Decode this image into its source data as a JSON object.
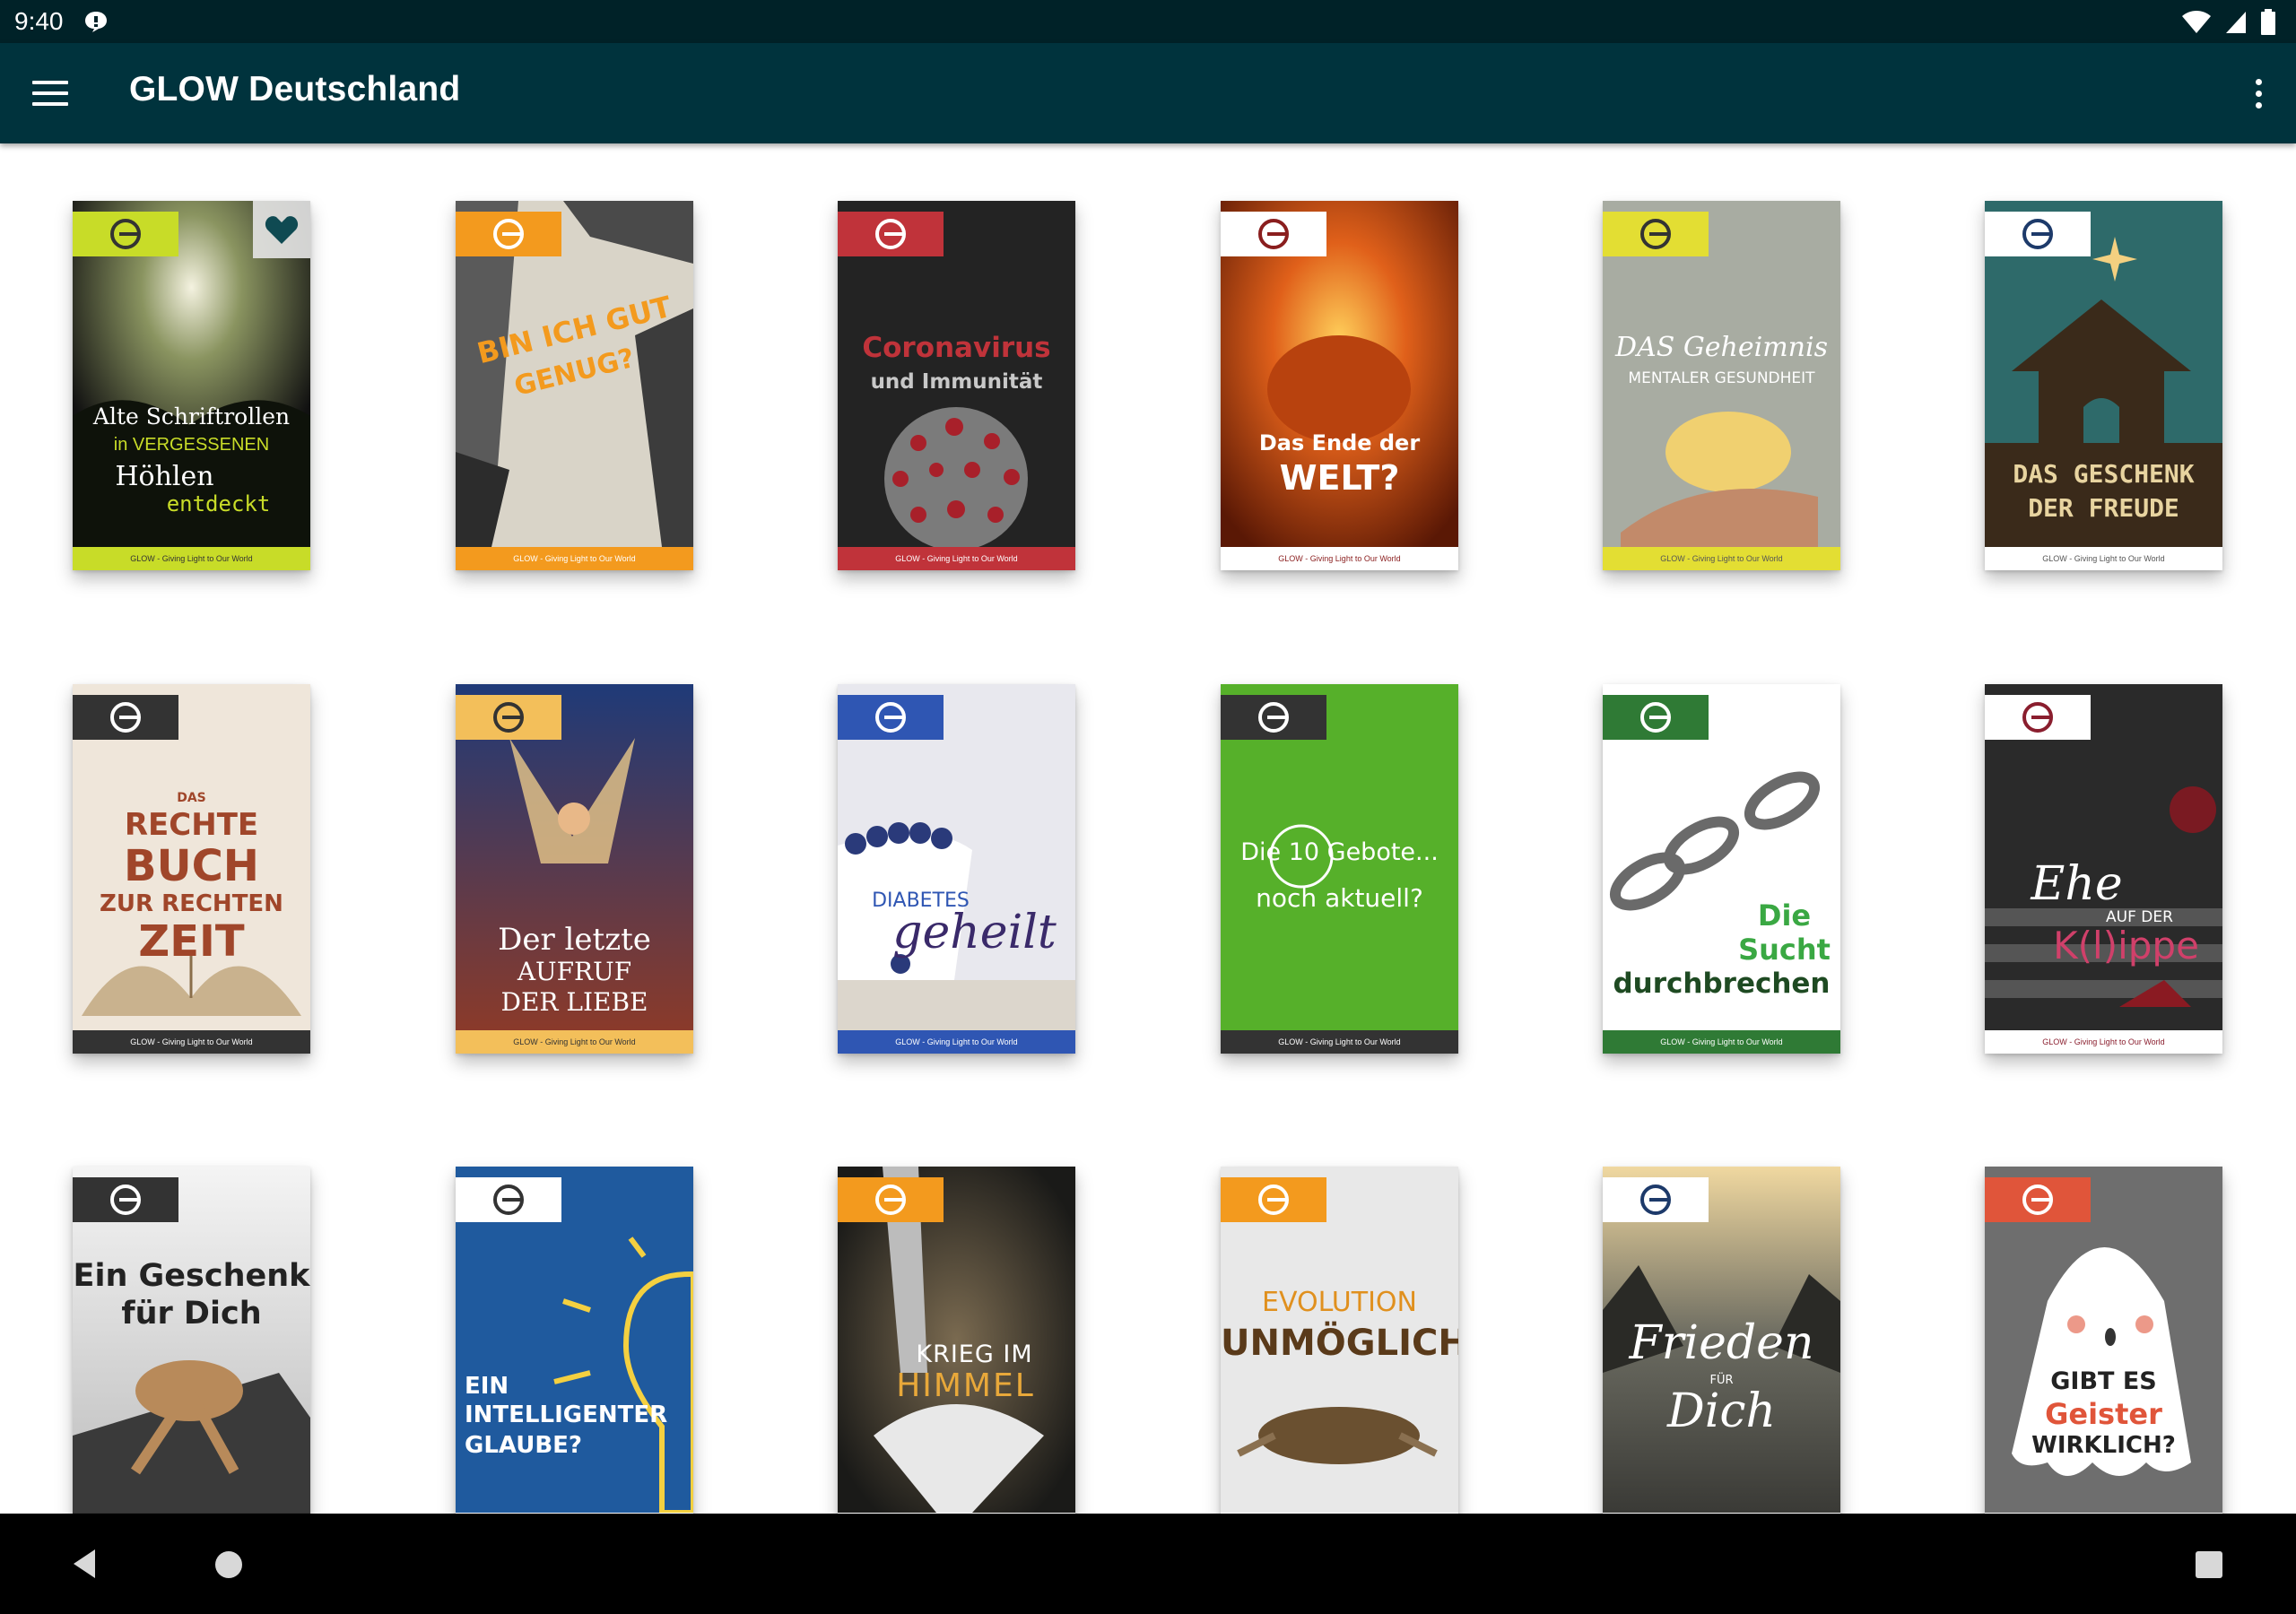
{
  "status_bar": {
    "time": "9:40"
  },
  "app_bar": {
    "title": "GLOW Deutschland"
  },
  "footer_text": "GLOW - Giving Light to Our World",
  "covers": [
    {
      "id": "alte-schriftrollen",
      "lines": [
        "Alte Schriftrollen",
        "in VERGESSENEN",
        "Höhlen",
        "entdeckt"
      ],
      "accent": "#c8dc28",
      "bg": "#1f2a12",
      "favorite": true
    },
    {
      "id": "bin-ich-gut-genug",
      "lines": [
        "BIN ICH GUT",
        "GENUG?"
      ],
      "accent": "#f39a1e",
      "bg": "#c9c4b8",
      "favorite": false
    },
    {
      "id": "coronavirus",
      "lines": [
        "Coronavirus",
        "und Immunität"
      ],
      "accent": "#c0333a",
      "bg": "#232323",
      "favorite": false
    },
    {
      "id": "ende-der-welt",
      "lines": [
        "Das Ende der",
        "WELT?"
      ],
      "accent": "#ffffff",
      "bg": "#b33a10",
      "favorite": false
    },
    {
      "id": "geheimnis-gesundheit",
      "lines": [
        "DAS Geheimnis",
        "MENTALER GESUNDHEIT"
      ],
      "accent": "#e3de33",
      "bg": "#a8aca2",
      "favorite": false
    },
    {
      "id": "geschenk-der-freude",
      "lines": [
        "DAS GESCHENK",
        "DER FREUDE"
      ],
      "accent": "#ffffff",
      "bg": "#2e6a6a",
      "favorite": false
    },
    {
      "id": "rechte-buch",
      "lines": [
        "DAS",
        "RECHTE",
        "BUCH",
        "ZUR RECHTEN",
        "ZEIT"
      ],
      "accent": "#333333",
      "bg": "#efe6da",
      "favorite": false
    },
    {
      "id": "letzte-aufruf",
      "lines": [
        "Der letzte",
        "AUFRUF",
        "DER LIEBE"
      ],
      "accent": "#f3bf5a",
      "bg": "#1f3a78",
      "favorite": false
    },
    {
      "id": "diabetes-geheilt",
      "lines": [
        "DIABETES",
        "geheilt"
      ],
      "accent": "#2f56b3",
      "bg": "#e8e8ee",
      "favorite": false
    },
    {
      "id": "zehn-gebote",
      "lines": [
        "Die 10 Gebote...",
        "noch aktuell?"
      ],
      "accent": "#333333",
      "bg": "#56b02a",
      "favorite": false
    },
    {
      "id": "sucht-durchbrechen",
      "lines": [
        "Die",
        "Sucht",
        "durchbrechen"
      ],
      "accent": "#2f7a35",
      "bg": "#ffffff",
      "favorite": false
    },
    {
      "id": "ehe-klippe",
      "lines": [
        "Ehe",
        "AUF DER",
        "K(l)ippe"
      ],
      "accent": "#ffffff",
      "bg": "#2a2a2a",
      "favorite": false
    },
    {
      "id": "geschenk-fuer-dich",
      "lines": [
        "Ein Geschenk",
        "für Dich"
      ],
      "accent": "#333333",
      "bg": "#e6e6e6",
      "favorite": false
    },
    {
      "id": "intelligenter-glaube",
      "lines": [
        "EIN",
        "INTELLIGENTER",
        "GLAUBE?"
      ],
      "accent": "#ffffff",
      "bg": "#1f5a9e",
      "favorite": false
    },
    {
      "id": "krieg-im-himmel",
      "lines": [
        "KRIEG IM",
        "HIMMEL"
      ],
      "accent": "#f39a1e",
      "bg": "#2a2a28",
      "favorite": false
    },
    {
      "id": "evolution-unmoeglich",
      "lines": [
        "EVOLUTION",
        "UNMÖGLICH"
      ],
      "accent": "#f39a1e",
      "bg": "#e8e8e8",
      "favorite": false
    },
    {
      "id": "frieden-fuer-dich",
      "lines": [
        "Frieden",
        "FÜR",
        "Dich"
      ],
      "accent": "#ffffff",
      "bg": "#5a5a50",
      "favorite": false
    },
    {
      "id": "geister-wirklich",
      "lines": [
        "GIBT ES",
        "Geister",
        "WIRKLICH?"
      ],
      "accent": "#e0553a",
      "bg": "#6e6e6e",
      "favorite": false
    }
  ]
}
